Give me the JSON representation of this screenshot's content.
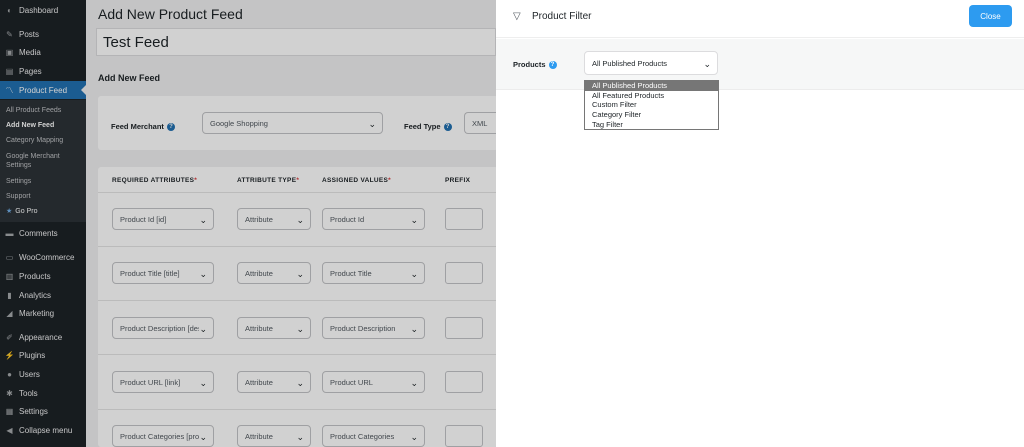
{
  "sidebar": {
    "items": [
      {
        "label": "Dashboard",
        "icon": "dashboard-icon",
        "glyph": "◐"
      },
      {
        "label": "Posts",
        "icon": "pin-icon",
        "glyph": "✎"
      },
      {
        "label": "Media",
        "icon": "media-icon",
        "glyph": "▣"
      },
      {
        "label": "Pages",
        "icon": "pages-icon",
        "glyph": "▤"
      },
      {
        "label": "Product Feed",
        "icon": "chart-line-icon",
        "glyph": "〽"
      },
      {
        "label": "Comments",
        "icon": "comment-icon",
        "glyph": "▬"
      },
      {
        "label": "WooCommerce",
        "icon": "woocommerce-icon",
        "glyph": "▭"
      },
      {
        "label": "Products",
        "icon": "archive-icon",
        "glyph": "▥"
      },
      {
        "label": "Analytics",
        "icon": "bar-chart-icon",
        "glyph": "▮"
      },
      {
        "label": "Marketing",
        "icon": "megaphone-icon",
        "glyph": "◢"
      },
      {
        "label": "Appearance",
        "icon": "brush-icon",
        "glyph": "✐"
      },
      {
        "label": "Plugins",
        "icon": "plug-icon",
        "glyph": "⚡"
      },
      {
        "label": "Users",
        "icon": "user-icon",
        "glyph": "●"
      },
      {
        "label": "Tools",
        "icon": "wrench-icon",
        "glyph": "✱"
      },
      {
        "label": "Settings",
        "icon": "settings-icon",
        "glyph": "▦"
      },
      {
        "label": "Collapse menu",
        "icon": "collapse-icon",
        "glyph": "◀"
      }
    ],
    "submenu": [
      "All Product Feeds",
      "Add New Feed",
      "Category Mapping",
      "Google Merchant",
      "Settings",
      "Settings",
      "Support",
      "Go Pro"
    ]
  },
  "main": {
    "page_title": "Add New Product Feed",
    "feed_name": "Test Feed",
    "section_title": "Add New Feed",
    "feed_merchant_label": "Feed Merchant",
    "feed_merchant_value": "Google Shopping",
    "feed_type_label": "Feed Type",
    "feed_type_value": "XML",
    "table": {
      "headers": [
        "REQUIRED ATTRIBUTES",
        "ATTRIBUTE TYPE",
        "ASSIGNED VALUES",
        "PREFIX"
      ],
      "required_mark": "*",
      "rows": [
        {
          "attribute": "Product Id [id]",
          "type": "Attribute",
          "value": "Product Id"
        },
        {
          "attribute": "Product Title [title]",
          "type": "Attribute",
          "value": "Product Title"
        },
        {
          "attribute": "Product Description [des",
          "type": "Attribute",
          "value": "Product Description"
        },
        {
          "attribute": "Product URL [link]",
          "type": "Attribute",
          "value": "Product URL"
        },
        {
          "attribute": "Product Categories [proc",
          "type": "Attribute",
          "value": "Product Categories"
        }
      ]
    }
  },
  "drawer": {
    "title": "Product Filter",
    "close_label": "Close",
    "products_label": "Products",
    "selected": "All Published Products",
    "options": [
      "All Published Products",
      "All Featured Products",
      "Custom Filter",
      "Category Filter",
      "Tag Filter"
    ]
  },
  "colors": {
    "sidebar_bg": "#1d2327",
    "active_menu": "#2271b1",
    "close_button": "#2d9bf0",
    "required_star": "#d63638"
  }
}
